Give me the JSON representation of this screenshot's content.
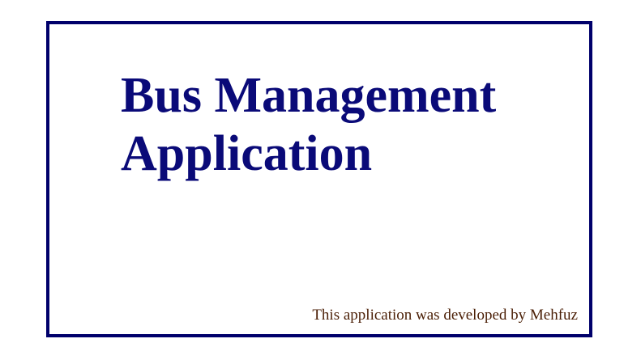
{
  "splash": {
    "title_line1": "Bus Management",
    "title_line2": "Application",
    "credit": "This application was developed by Mehfuz"
  },
  "colors": {
    "border": "#00006b",
    "title": "#0a0a78",
    "credit": "#4a1e05",
    "background": "#ffffff"
  }
}
